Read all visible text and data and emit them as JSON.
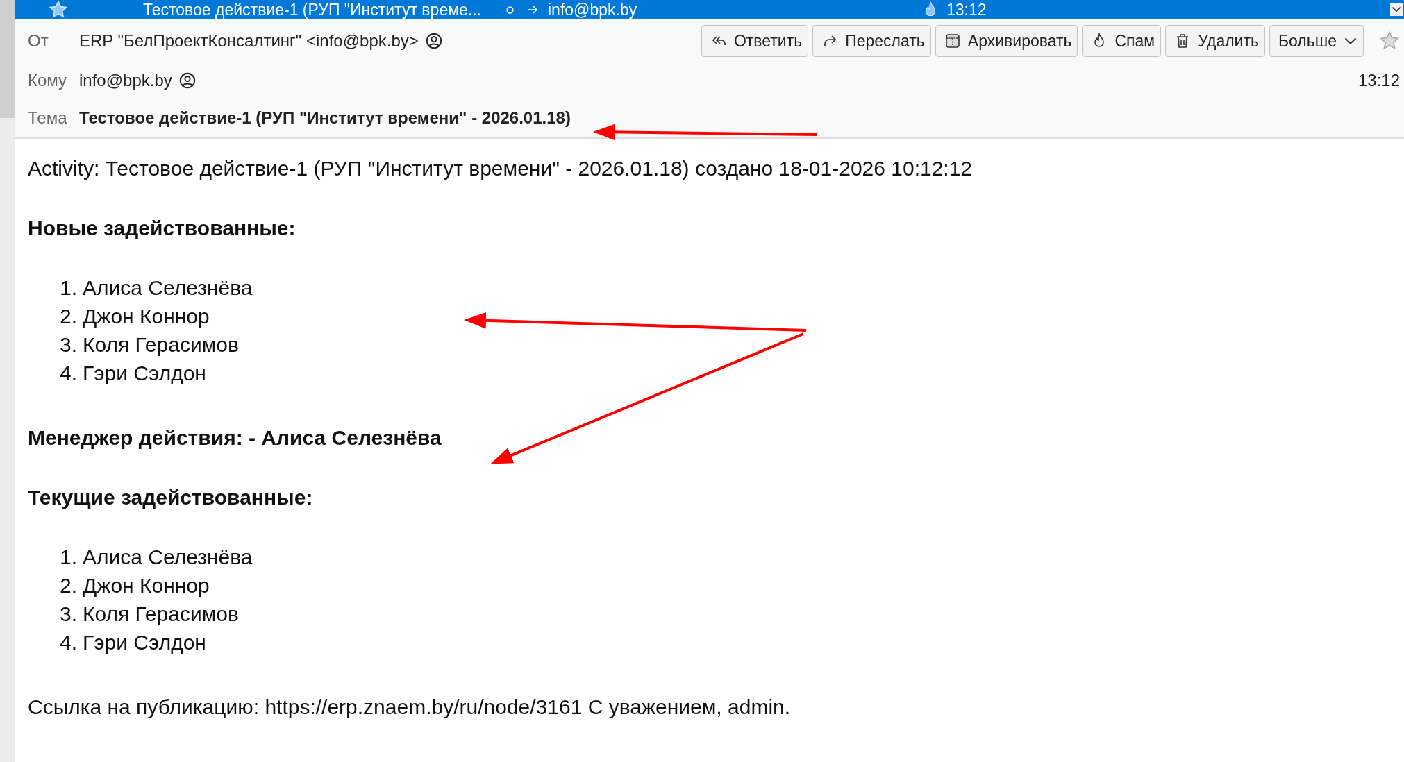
{
  "message_list": {
    "rows": [
      {
        "subject": "Тестовое действие-1 (РУП \"Институт време...",
        "recipient": "info@bpk.by",
        "time": "13:12",
        "starred": true,
        "unread": true,
        "selected": true
      }
    ]
  },
  "header": {
    "from_label": "От",
    "from": "ERP \"БелПроектКонсалтинг\" <info@bpk.by>",
    "to_label": "Кому",
    "to": "info@bpk.by",
    "subject_label": "Тема",
    "subject": "Тестовое действие-1 (РУП \"Институт времени\" - 2026.01.18)",
    "time": "13:12",
    "starred": false,
    "buttons": [
      {
        "kind": "reply",
        "label": "Ответить"
      },
      {
        "kind": "forward",
        "label": "Переслать"
      },
      {
        "kind": "archive",
        "label": "Архивировать"
      },
      {
        "kind": "spam",
        "label": "Спам"
      },
      {
        "kind": "delete",
        "label": "Удалить"
      },
      {
        "kind": "more",
        "label": "Больше"
      }
    ]
  },
  "body": [
    {
      "kind": "text",
      "text": "Activity: Тестовое действие-1 (РУП \"Институт времени\" - 2026.01.18) создано 18-01-2026 10:12:12"
    },
    {
      "kind": "heading",
      "text": "Новые задействованные:"
    },
    {
      "kind": "list",
      "items": [
        {
          "number": "1.",
          "name": "Алиса Селезнёва"
        },
        {
          "number": "2.",
          "name": "Джон Коннор"
        },
        {
          "number": "3.",
          "name": "Коля Герасимов"
        },
        {
          "number": "4.",
          "name": "Гэри Сэлдон"
        }
      ]
    },
    {
      "kind": "heading",
      "text": "Менеджер действия: - Алиса Селезнёва"
    },
    {
      "kind": "heading",
      "text": "Текущие задействованные:"
    },
    {
      "kind": "list",
      "items": [
        {
          "number": "1.",
          "name": "Алиса Селезнёва"
        },
        {
          "number": "2.",
          "name": "Джон Коннор"
        },
        {
          "number": "3.",
          "name": "Коля Герасимов"
        },
        {
          "number": "4.",
          "name": "Гэри Сэлдон"
        }
      ]
    },
    {
      "kind": "text",
      "text": "Ссылка на публикацию: https://erp.znaem.by/ru/node/3161 С уважением, admin."
    }
  ]
}
